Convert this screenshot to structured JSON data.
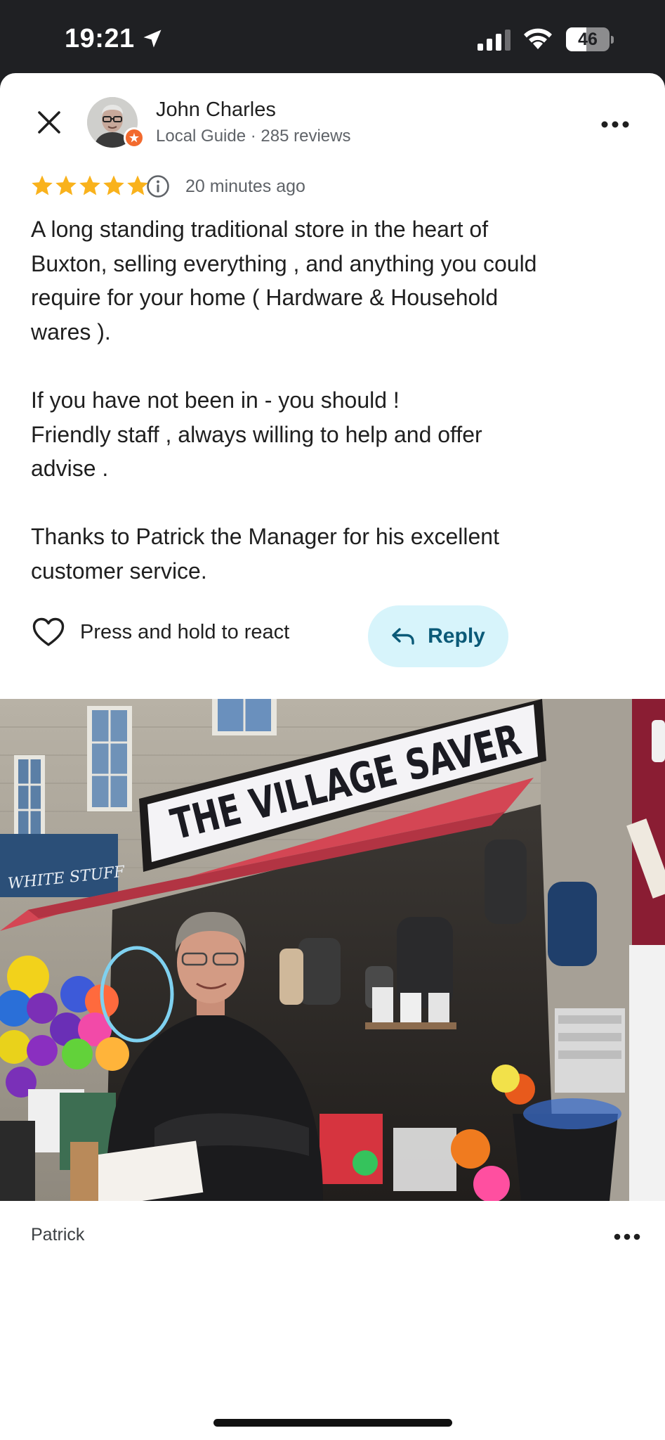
{
  "status_bar": {
    "time": "19:21",
    "battery_level": "46",
    "icons": [
      "location-arrow-icon",
      "cellular-signal-icon",
      "wifi-icon",
      "battery-icon"
    ]
  },
  "review": {
    "reviewer_name": "John Charles",
    "reviewer_meta": "Local Guide · 285 reviews",
    "rating": 5,
    "time_ago": "20 minutes ago",
    "text": "A long standing traditional store in the heart of\nBuxton, selling everything , and anything you could\nrequire for your home ( Hardware & Household\nwares ).\n\nIf you have not been in - you should !\nFriendly staff , always willing to help and offer\nadvise .\n\nThanks to Patrick the Manager for his excellent\ncustomer service.",
    "react_label": "Press and hold to react",
    "reply_label": "Reply"
  },
  "photo": {
    "shop_sign": "THE VILLAGE SAVER",
    "neighbor_sign": "WHITE STUFF",
    "caption": "Patrick"
  },
  "colors": {
    "star": "#f9b21c",
    "reply_bg": "#d7f4fb",
    "reply_text": "#0b5a78",
    "guide_badge": "#f26a2e",
    "awning": "#d44654"
  }
}
